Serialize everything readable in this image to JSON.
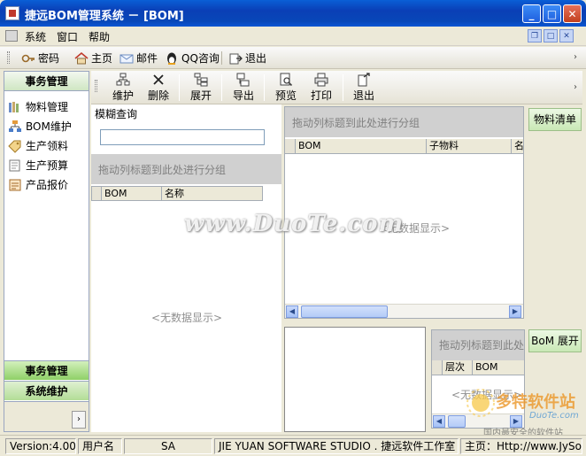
{
  "window": {
    "title": "捷远BOM管理系统 － [BOM]"
  },
  "menu": {
    "items": [
      "系统",
      "窗口",
      "帮助"
    ]
  },
  "toolbar1": {
    "items": [
      "密码",
      "主页",
      "邮件",
      "QQ咨询",
      "退出"
    ]
  },
  "nav": {
    "header": "事务管理",
    "items": [
      "物料管理",
      "BOM维护",
      "生产领料",
      "生产预算",
      "产品报价"
    ],
    "groups": [
      "事务管理",
      "系统维护"
    ]
  },
  "toolbar2": {
    "items": [
      "维护",
      "删除",
      "展开",
      "导出",
      "预览",
      "打印",
      "退出"
    ]
  },
  "search": {
    "label": "模糊查询",
    "value": ""
  },
  "grid_left": {
    "group_hint": "拖动列标题到此处进行分组",
    "columns": [
      "BOM",
      "名称"
    ],
    "empty": "<无数据显示>"
  },
  "grid_main": {
    "group_hint": "拖动列标题到此处进行分组",
    "columns": [
      "BOM",
      "子物料",
      "名"
    ],
    "empty": "<无数据显示>"
  },
  "grid_small": {
    "group_hint": "拖动列标题到此处进行分组",
    "columns": [
      "层次",
      "BOM"
    ],
    "empty": "<无数据显示>"
  },
  "right_tabs": [
    "物料清单",
    "BoM 展开"
  ],
  "statusbar": {
    "version": "Version:4.00",
    "user_label": "用户名",
    "user": "SA",
    "studio": "JIE YUAN SOFTWARE STUDIO . 捷远软件工作室",
    "homepage": "主页：Http://www.JySoft.cn"
  },
  "watermarks": {
    "center": "www.DuoTe.com",
    "corner_title": "多特软件站",
    "corner_site": "DuoTe.com",
    "corner_slogan": "国内最安全的软件站"
  },
  "colors": {
    "title_bar": "#0a3fb6",
    "nav_group_active": "#8fd067",
    "group_bar": "#d0d0d0"
  }
}
